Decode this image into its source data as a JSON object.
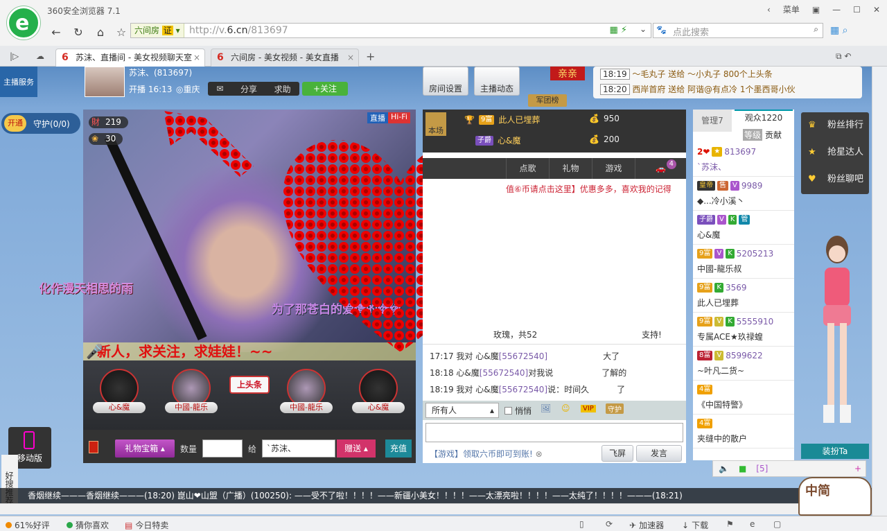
{
  "browser": {
    "title": "360安全浏览器 7.1",
    "menu_label": "菜单",
    "address_badge": "六间房",
    "address_cert": "证",
    "url_prefix": "http://v.",
    "url_domain": "6.cn",
    "url_path": "/813697",
    "search_placeholder": "点此搜索"
  },
  "tabs": [
    {
      "label": "苏沫、直播间 - 美女视频聊天室"
    },
    {
      "label": "六间房 - 美女视频 - 美女直播"
    }
  ],
  "status": {
    "rating": "61%好评",
    "guess": "猜你喜欢",
    "today": "今日特卖",
    "accelerator": "加速器",
    "download": "下载"
  },
  "left_rail": {
    "host_service": "主播服务",
    "open_label": "开通",
    "guard": "守护(0/0)",
    "mobile": "移动版",
    "good_search": "好搜推荐"
  },
  "anchor": {
    "name": "苏沫、(813697)",
    "time": "开播 16:13",
    "location": "重庆",
    "share": "分享",
    "help": "求助",
    "follow": "关注",
    "room_settings": "房间设置",
    "host_dynamic": "主播动态",
    "army_list": "军团榜",
    "rank_badge": "亲亲"
  },
  "headlines": [
    {
      "time": "18:19",
      "text": "〜毛丸子 送给 〜小丸子 800个上头条"
    },
    {
      "time": "18:20",
      "text": "西岸首府 送给 阿谐@有点冷 1个墨西哥小伙"
    }
  ],
  "video": {
    "wealth": "219",
    "score": "30",
    "live_label": "直播",
    "hifi": "Hi-Fi",
    "overlay1": "化作漫天相思的雨",
    "overlay2": "为了那苍白的爱情的继续",
    "banner": "新人，求关注，求娃娃！~~"
  },
  "gift_strip": [
    {
      "label": "心&魔"
    },
    {
      "label": "中國-龍乐"
    },
    {
      "label": "上头条"
    },
    {
      "label": "中國-龍乐"
    },
    {
      "label": "心&魔"
    }
  ],
  "giftbar": {
    "box": "礼物宝箱",
    "qty_label": "数量",
    "give_label": "给",
    "recipient": "`苏沫、",
    "send": "赠送",
    "recharge": "充值"
  },
  "chat": {
    "this_show": "本场",
    "top": [
      {
        "rank": "9富",
        "name": "此人已埋葬",
        "amount": "950"
      },
      {
        "rank": "子爵",
        "name": "心&魔",
        "amount": "200"
      }
    ],
    "tabs": [
      "点歌",
      "礼物",
      "游戏"
    ],
    "car_count": "4",
    "promo": "值⑥币请点击这里】优惠多多，喜欢我的记得",
    "gift_msg": "玫瑰，共52",
    "support": "支持!",
    "messages": [
      {
        "time": "17:17",
        "pre": "我对 心&魔",
        "uid": "[55672540]",
        "text": "",
        "suffix": "大了"
      },
      {
        "time": "18:18",
        "pre": "心&魔",
        "uid": "[55672540]",
        "text": "对我说",
        "suffix": "了解的"
      },
      {
        "time": "18:19",
        "pre": "我对 心&魔",
        "uid": "[55672540]",
        "text": "说：时间久",
        "suffix": "了"
      }
    ],
    "to": "所有人",
    "whisper": "悄悄",
    "guard": "守护",
    "vip": "VIP",
    "game_tip": "【游戏】领取六币即可到账!",
    "fly": "飞屏",
    "send": "发言"
  },
  "audience": {
    "manage": "管理7",
    "viewers": "观众1220",
    "level": "等级",
    "contrib": "贡献",
    "rows": [
      {
        "id": "813697",
        "name": "`苏沫、"
      },
      {
        "id": "9989",
        "name": "◆...冷小溪丶"
      },
      {
        "id": "",
        "name": "心&魔"
      },
      {
        "id": "5205213",
        "name": "中國-龍乐叔"
      },
      {
        "id": "3569",
        "name": "此人已埋葬"
      },
      {
        "id": "5555910",
        "name": "专属ACE★玖禄蝗"
      },
      {
        "id": "8599622",
        "name": "~叶凡二货~"
      },
      {
        "id": "",
        "name": "《中国特警》"
      },
      {
        "id": "",
        "name": "夹缝中的散户"
      }
    ],
    "footer_count": "[5]"
  },
  "right_menu": [
    "粉丝排行",
    "抢星达人",
    "粉丝聊吧"
  ],
  "dress_up": "装扮Ta",
  "ticker": "香烟继续———香烟继续———(18:20)  崑山❤山盟（广播）(100250): ——受不了啦！！！！——新疆小美女！！！！——太漂亮啦！！！！——太纯了！！！！———(18:21)",
  "mascot": "中简"
}
